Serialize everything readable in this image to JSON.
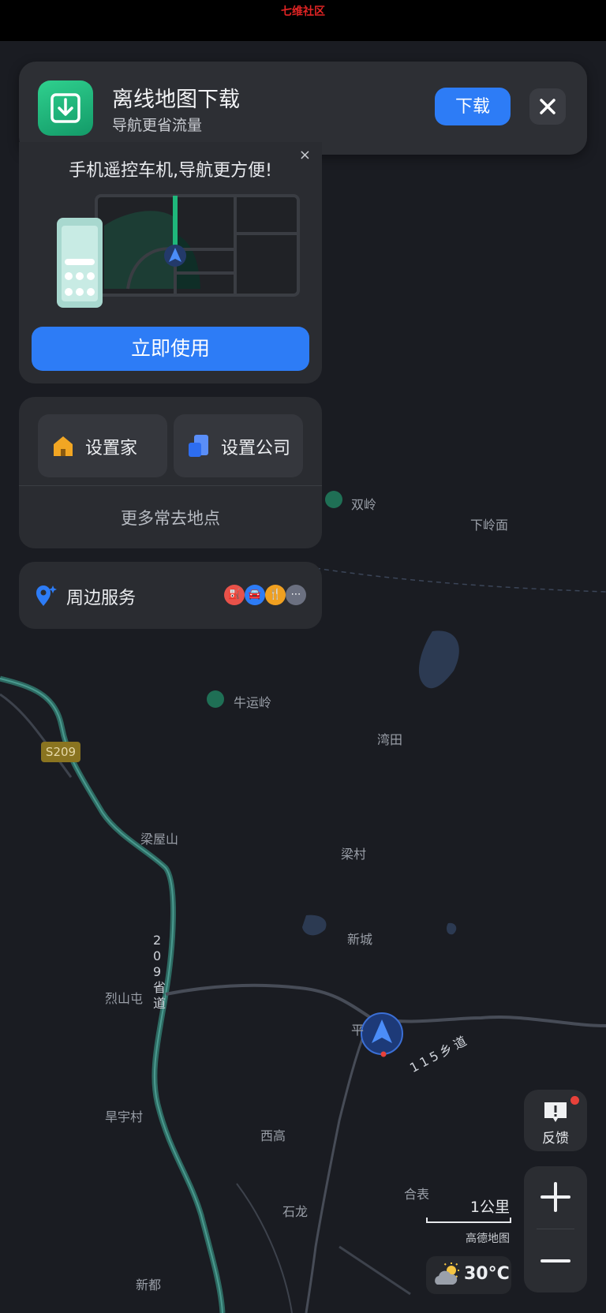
{
  "top_bar": {
    "brand": "七维社区"
  },
  "banner": {
    "title": "离线地图下载",
    "subtitle": "导航更省流量",
    "download_label": "下载",
    "close_icon": "close-icon",
    "app_icon": "download-box-icon"
  },
  "promo": {
    "headline": "手机遥控车机,导航更方便!",
    "use_button": "立即使用",
    "dismiss": "×"
  },
  "places": {
    "home_label": "设置家",
    "work_label": "设置公司",
    "more_label": "更多常去地点"
  },
  "nearby": {
    "label": "周边服务",
    "categories": [
      {
        "icon": "gas-station-icon",
        "color": "#e8524a"
      },
      {
        "icon": "car-icon",
        "color": "#2d7cf6"
      },
      {
        "icon": "food-icon",
        "color": "#f0a020"
      },
      {
        "icon": "more-icon",
        "color": "#6b7080"
      }
    ]
  },
  "map": {
    "places": [
      "双岭",
      "下岭面",
      "牛运岭",
      "湾田",
      "梁屋山",
      "梁村",
      "新城",
      "烈山屯",
      "平",
      "旱宇村",
      "西高",
      "合表",
      "石龙",
      "新都"
    ],
    "road_badge": "S209",
    "road_name_provincial": "209省道",
    "road_name_village": "115乡道"
  },
  "controls": {
    "feedback_label": "反馈",
    "zoom_in": "+",
    "zoom_out": "−",
    "scale_value": "1公里",
    "map_brand": "高德地图",
    "temperature": "30°C"
  },
  "colors": {
    "accent": "#2d7cf6",
    "brand_green": "#1fb77b",
    "alert": "#e8413a"
  }
}
